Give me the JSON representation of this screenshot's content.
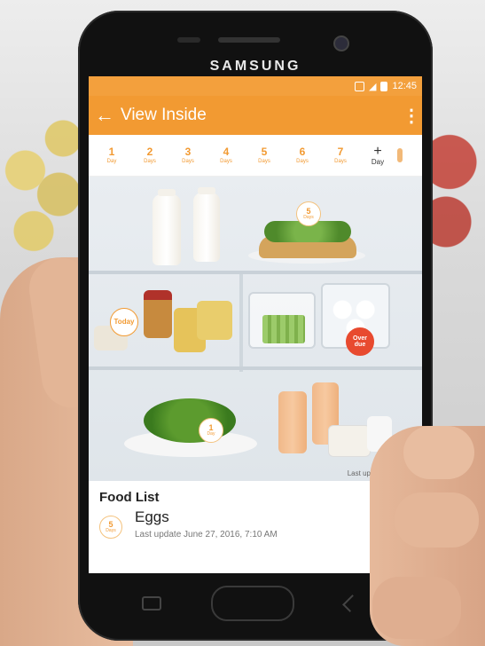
{
  "device": {
    "brand": "SAMSUNG"
  },
  "status_bar": {
    "time": "12:45"
  },
  "app_bar": {
    "title": "View Inside"
  },
  "day_filters": [
    {
      "num": "1",
      "unit": "Day"
    },
    {
      "num": "2",
      "unit": "Days"
    },
    {
      "num": "3",
      "unit": "Days"
    },
    {
      "num": "4",
      "unit": "Days"
    },
    {
      "num": "5",
      "unit": "Days"
    },
    {
      "num": "6",
      "unit": "Days"
    },
    {
      "num": "7",
      "unit": "Days"
    }
  ],
  "add_day": {
    "plus": "+",
    "label": "Day"
  },
  "fridge_badges": {
    "cake": {
      "num": "5",
      "unit": "Days"
    },
    "top_left_jar": {
      "label": "Today"
    },
    "eggs": {
      "label": "Over due"
    },
    "salad": {
      "num": "1",
      "unit": "Day"
    }
  },
  "fridge": {
    "last_updated": "Last updated 4:51 PM"
  },
  "food_list": {
    "title": "Food List",
    "items": [
      {
        "badge_num": "5",
        "badge_unit": "Days",
        "name": "Eggs",
        "sub": "Last update June 27, 2016, 7:10 AM"
      }
    ]
  },
  "colors": {
    "accent": "#f29a32",
    "overdue": "#e84a2f"
  }
}
